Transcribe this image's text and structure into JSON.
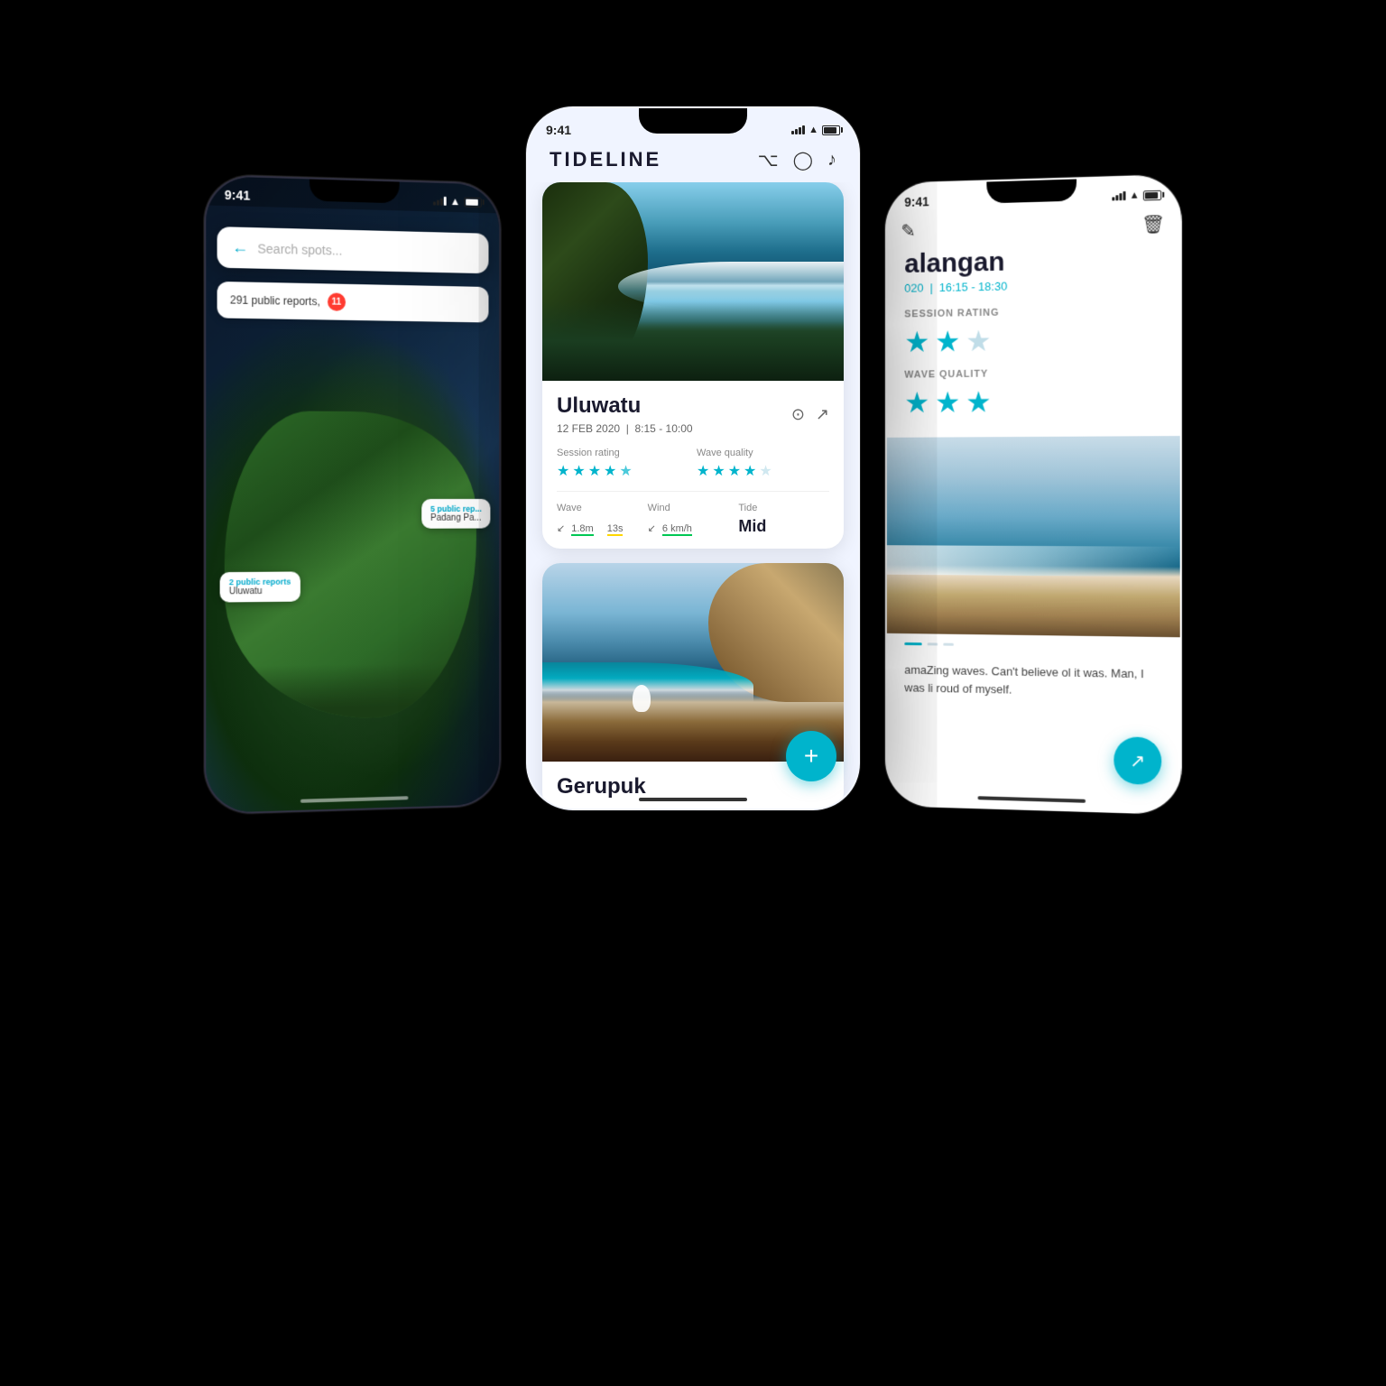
{
  "app": {
    "name": "TIDELINE",
    "status_time": "9:41"
  },
  "left_phone": {
    "status_time": "9:41",
    "search_placeholder": "Search spots...",
    "reports_text": "291 public reports,",
    "badge_count": "11",
    "pin_uluwatu": {
      "reports": "2 public reports",
      "name": "Uluwatu"
    },
    "pin_padang": {
      "reports": "5 public rep...",
      "name": "Padang Pa..."
    }
  },
  "center_phone": {
    "status_time": "9:41",
    "app_title": "TIDELINE",
    "cards": [
      {
        "name": "Uluwatu",
        "date": "12 FEB 2020",
        "time": "8:15 - 10:00",
        "session_rating_stars": [
          1,
          1,
          1,
          1,
          0.5
        ],
        "wave_quality_stars": [
          1,
          1,
          1,
          1,
          0.5
        ],
        "wave_height": "1.8",
        "wave_height_unit": "m",
        "wave_period": "13",
        "wave_period_unit": "s",
        "wind_speed": "6",
        "wind_unit": "km/h",
        "tide": "Mid",
        "session_rating_label": "Session rating",
        "wave_quality_label": "Wave quality",
        "wave_label": "Wave",
        "wind_label": "Wind",
        "tide_label": "Tide"
      },
      {
        "name": "Gerupuk",
        "date": "",
        "time": ""
      }
    ],
    "fab_label": "+"
  },
  "right_phone": {
    "status_time": "9:41",
    "session_title": "alangan",
    "session_date_year": "020",
    "session_time": "16:15 - 18:30",
    "session_rating_label": "SESSION RATING",
    "wave_quality_label": "WAVE QUALITY",
    "session_rating_stars": [
      1,
      1,
      0.5
    ],
    "wave_quality_stars": [
      1,
      1,
      1
    ],
    "notes": "amaZing waves. Can't believe ol it was. Man, I was li roud of myself.",
    "share_icon": "↗"
  }
}
